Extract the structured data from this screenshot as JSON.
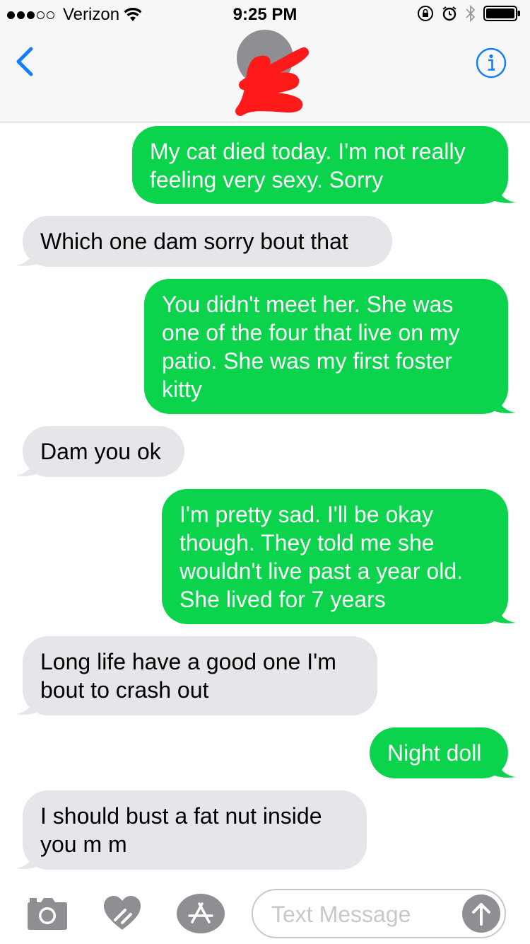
{
  "status_bar": {
    "signal_bars_full": 3,
    "signal_bars_total": 5,
    "carrier": "Verizon",
    "time": "9:25 PM",
    "icons": [
      "wifi-icon",
      "orientation-lock-icon",
      "alarm-icon",
      "bluetooth-icon",
      "battery-icon"
    ]
  },
  "nav": {
    "back_icon": "chevron-left-icon",
    "info_icon": "info-icon",
    "accent_color": "#147efb"
  },
  "colors": {
    "sent_bubble": "#0bd34c",
    "received_bubble": "#e5e5ea"
  },
  "messages": [
    {
      "direction": "sent",
      "lines": [
        "My cat died today. I'm not really",
        "feeling very sexy. Sorry"
      ]
    },
    {
      "direction": "received",
      "lines": [
        "Which one dam sorry bout that"
      ]
    },
    {
      "direction": "sent",
      "lines": [
        "You didn't meet her. She was",
        "one of the four that live on my",
        "patio. She was my first foster",
        "kitty"
      ]
    },
    {
      "direction": "received",
      "lines": [
        "Dam you ok"
      ]
    },
    {
      "direction": "sent",
      "lines": [
        "I'm pretty sad. I'll be okay",
        "though. They told me she",
        "wouldn't live past a year old.",
        "She lived for 7 years"
      ]
    },
    {
      "direction": "received",
      "lines": [
        "Long life have a good one I'm",
        "bout to crash out"
      ]
    },
    {
      "direction": "sent",
      "lines": [
        "Night doll"
      ]
    },
    {
      "direction": "received",
      "lines": [
        "I should bust a fat nut inside",
        "you m m"
      ]
    }
  ],
  "input_bar": {
    "placeholder": "Text Message",
    "icons": [
      "camera-icon",
      "digital-touch-heart-icon",
      "app-store-icon",
      "send-arrow-icon"
    ]
  }
}
